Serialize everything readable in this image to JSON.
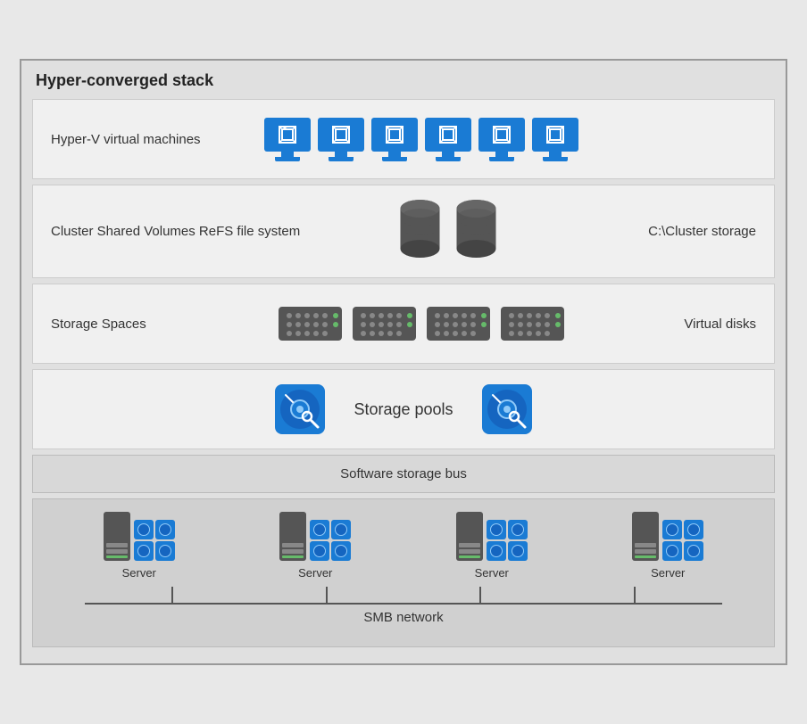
{
  "diagram": {
    "title": "Hyper-converged stack",
    "layers": [
      {
        "id": "hyperv",
        "label": "Hyper-V virtual machines",
        "right_label": "",
        "icon_type": "monitors",
        "icon_count": 6
      },
      {
        "id": "csv",
        "label": "Cluster Shared Volumes ReFS file system",
        "right_label": "C:\\Cluster storage",
        "icon_type": "cylinders",
        "icon_count": 2
      },
      {
        "id": "storage_spaces",
        "label": "Storage Spaces",
        "right_label": "Virtual disks",
        "icon_type": "nas",
        "icon_count": 4
      },
      {
        "id": "storage_pools",
        "label": "Storage pools",
        "right_label": "",
        "icon_type": "disk_pool",
        "icon_count": 2
      }
    ],
    "bus_label": "Software storage bus",
    "servers": [
      {
        "label": "Server"
      },
      {
        "label": "Server"
      },
      {
        "label": "Server"
      },
      {
        "label": "Server"
      }
    ],
    "smb_label": "SMB network"
  }
}
